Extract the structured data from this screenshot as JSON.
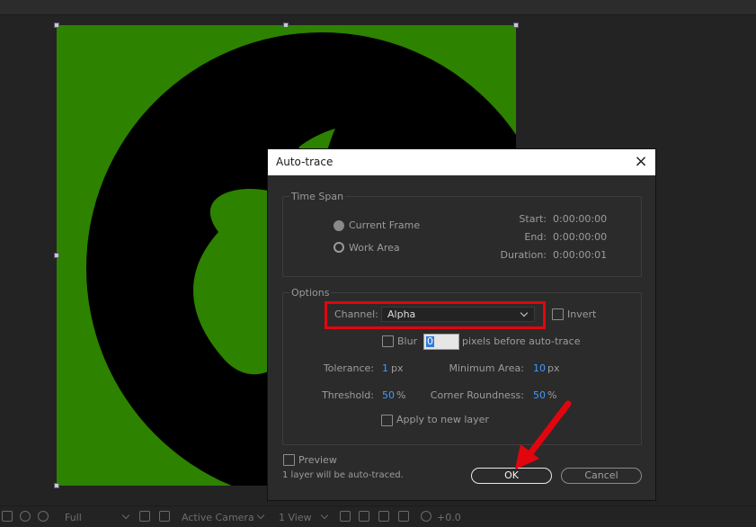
{
  "dialog": {
    "title": "Auto-trace",
    "close_icon": "close-icon",
    "time_span": {
      "label": "Time Span",
      "current_frame_label": "Current Frame",
      "work_area_label": "Work Area",
      "selected": "Current Frame",
      "start_label": "Start:",
      "start_value": "0:00:00:00",
      "end_label": "End:",
      "end_value": "0:00:00:00",
      "duration_label": "Duration:",
      "duration_value": "0:00:00:01"
    },
    "options": {
      "label": "Options",
      "channel_label": "Channel:",
      "channel_value": "Alpha",
      "invert_label": "Invert",
      "invert_checked": false,
      "blur_label": "Blur",
      "blur_checked": false,
      "blur_value": "0",
      "blur_suffix": "pixels before auto-trace",
      "tolerance_label": "Tolerance:",
      "tolerance_value": "1",
      "tolerance_unit": "px",
      "min_area_label": "Minimum Area:",
      "min_area_value": "10",
      "min_area_unit": "px",
      "threshold_label": "Threshold:",
      "threshold_value": "50",
      "threshold_unit": "%",
      "corner_label": "Corner Roundness:",
      "corner_value": "50",
      "corner_unit": "%",
      "apply_new_layer_label": "Apply to new layer",
      "apply_new_layer_checked": false
    },
    "preview_label": "Preview",
    "preview_checked": false,
    "status_text": "1 layer will be auto-traced.",
    "ok_label": "OK",
    "cancel_label": "Cancel"
  },
  "viewer_toolbar": {
    "resolution": "Full",
    "camera": "Active Camera",
    "views": "1 View",
    "exposure": "+0.0"
  },
  "colors": {
    "canvas_green": "#2d8200",
    "highlight_red": "#e3050e",
    "accent_blue": "#3f9bff"
  }
}
